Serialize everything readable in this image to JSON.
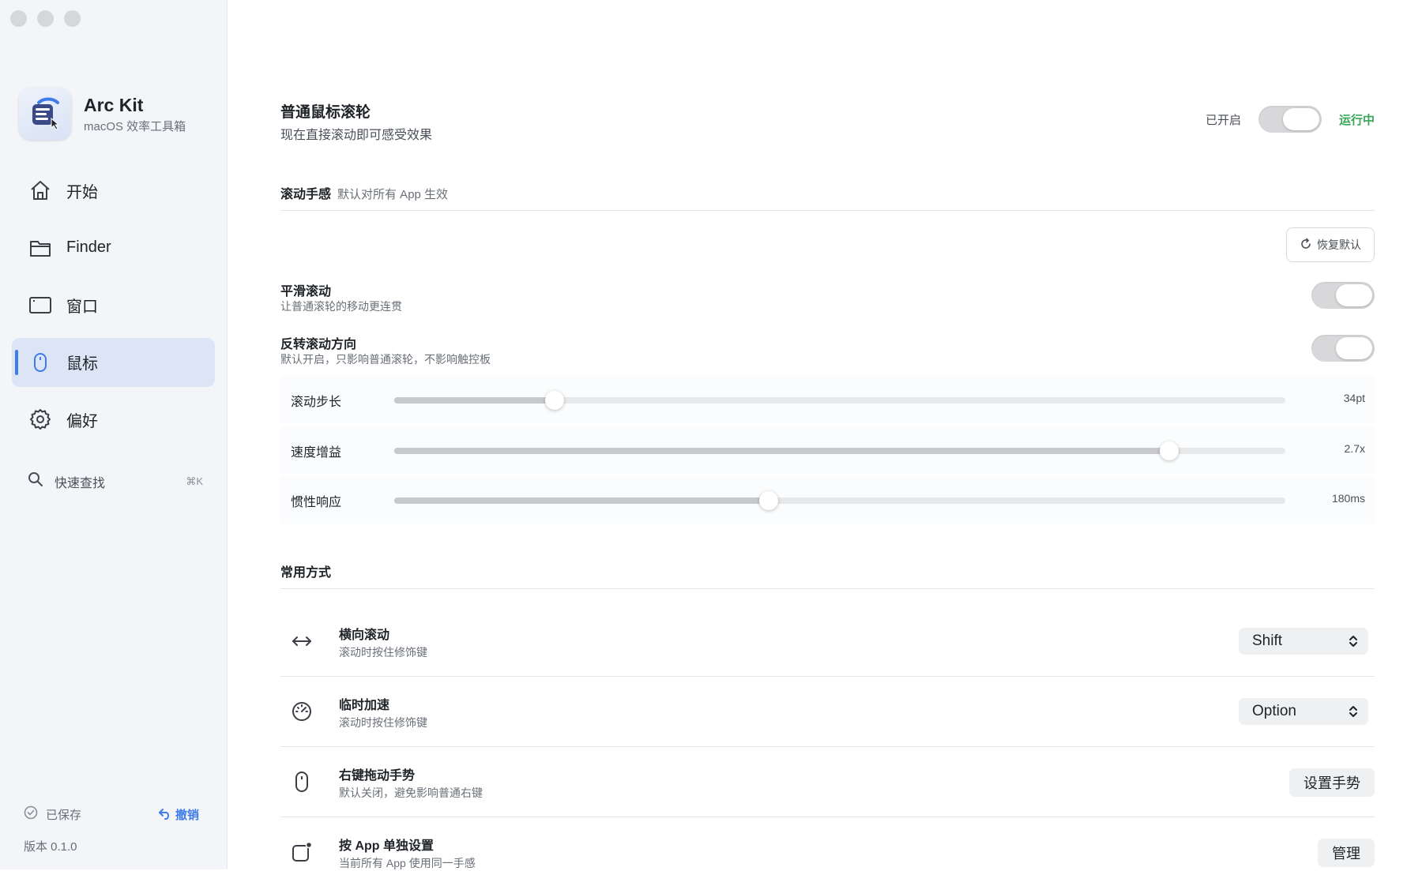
{
  "sidebar": {
    "brand": {
      "name": "Arc Kit",
      "subtitle": "macOS 效率工具箱"
    },
    "nav": [
      {
        "label": "开始",
        "icon": "home-icon",
        "active": false
      },
      {
        "label": "Finder",
        "icon": "folder-icon",
        "active": false
      },
      {
        "label": "窗口",
        "icon": "window-icon",
        "active": false
      },
      {
        "label": "鼠标",
        "icon": "mouse-icon",
        "active": true
      },
      {
        "label": "偏好",
        "icon": "gear-icon",
        "active": false
      }
    ],
    "quick_search": {
      "label": "快速查找",
      "shortcut": "⌘K"
    },
    "footer": {
      "saved_label": "已保存",
      "undo_label": "撤销",
      "version": "版本 0.1.0"
    }
  },
  "main": {
    "header": {
      "title": "普通鼠标滚轮",
      "subtitle": "现在直接滚动即可感受效果",
      "enabled_label": "已开启",
      "status": "运行中",
      "toggle_on": true
    },
    "scroll_feel": {
      "title": "滚动手感",
      "note": "默认对所有 App 生效",
      "reset_label": "恢复默认",
      "toggles": [
        {
          "title": "平滑滚动",
          "subtitle": "让普通滚轮的移动更连贯",
          "on": true
        },
        {
          "title": "反转滚动方向",
          "subtitle": "默认开启，只影响普通滚轮，不影响触控板",
          "on": true
        }
      ],
      "sliders": [
        {
          "label": "滚动步长",
          "value_text": "34pt",
          "fraction": 0.18
        },
        {
          "label": "速度增益",
          "value_text": "2.7x",
          "fraction": 0.87
        },
        {
          "label": "惯性响应",
          "value_text": "180ms",
          "fraction": 0.42
        }
      ]
    },
    "common": {
      "title": "常用方式",
      "rows": [
        {
          "title": "横向滚动",
          "subtitle": "滚动时按住修饰键",
          "icon": "horizontal-arrows-icon",
          "control": "select",
          "value": "Shift"
        },
        {
          "title": "临时加速",
          "subtitle": "滚动时按住修饰键",
          "icon": "speedometer-icon",
          "control": "select",
          "value": "Option"
        },
        {
          "title": "右键拖动手势",
          "subtitle": "默认关闭，避免影响普通右键",
          "icon": "mouse-icon",
          "control": "button",
          "value": "设置手势"
        },
        {
          "title": "按 App 单独设置",
          "subtitle": "当前所有 App 使用同一手感",
          "icon": "app-badge-icon",
          "control": "button",
          "value": "管理"
        }
      ]
    }
  },
  "colors": {
    "accent": "#3f7ce8",
    "running": "#3aa757",
    "sidebar_bg": "#f3f5f9",
    "active_nav_bg": "#dbe5f6"
  }
}
